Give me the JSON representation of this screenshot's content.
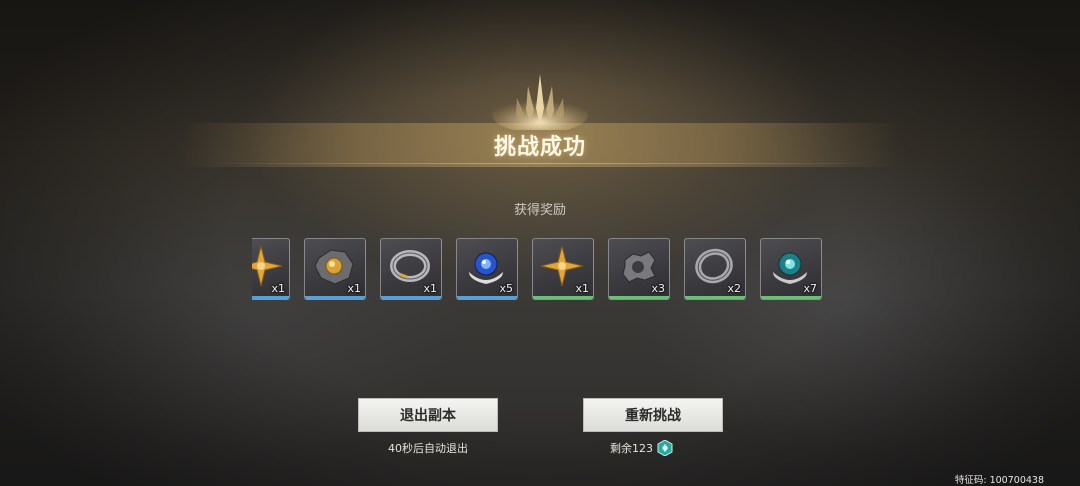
{
  "header": {
    "title": "挑战成功",
    "subtitle": "获得奖励"
  },
  "rewards": [
    {
      "icon": "golden-shuriken-icon",
      "qty": "x1",
      "rarity_color": "#5aa0d8"
    },
    {
      "icon": "golden-orb-fragment-icon",
      "qty": "x1",
      "rarity_color": "#5aa0d8"
    },
    {
      "icon": "silver-ring-icon",
      "qty": "x1",
      "rarity_color": "#5aa0d8"
    },
    {
      "icon": "blue-core-orb-icon",
      "qty": "x5",
      "rarity_color": "#5aa0d8"
    },
    {
      "icon": "golden-shuriken-icon",
      "qty": "x1",
      "rarity_color": "#6bbf76"
    },
    {
      "icon": "gear-fragment-icon",
      "qty": "x3",
      "rarity_color": "#6bbf76"
    },
    {
      "icon": "steel-ring-icon",
      "qty": "x2",
      "rarity_color": "#6bbf76"
    },
    {
      "icon": "teal-core-orb-icon",
      "qty": "x7",
      "rarity_color": "#6bbf76"
    }
  ],
  "actions": {
    "exit_label": "退出副本",
    "exit_hint": "40秒后自动退出",
    "retry_label": "重新挑战",
    "retry_hint": "剩余123",
    "retry_currency_icon": "stamina-crystal-icon"
  },
  "footer": {
    "feature_code": "特征码: 100700438"
  }
}
